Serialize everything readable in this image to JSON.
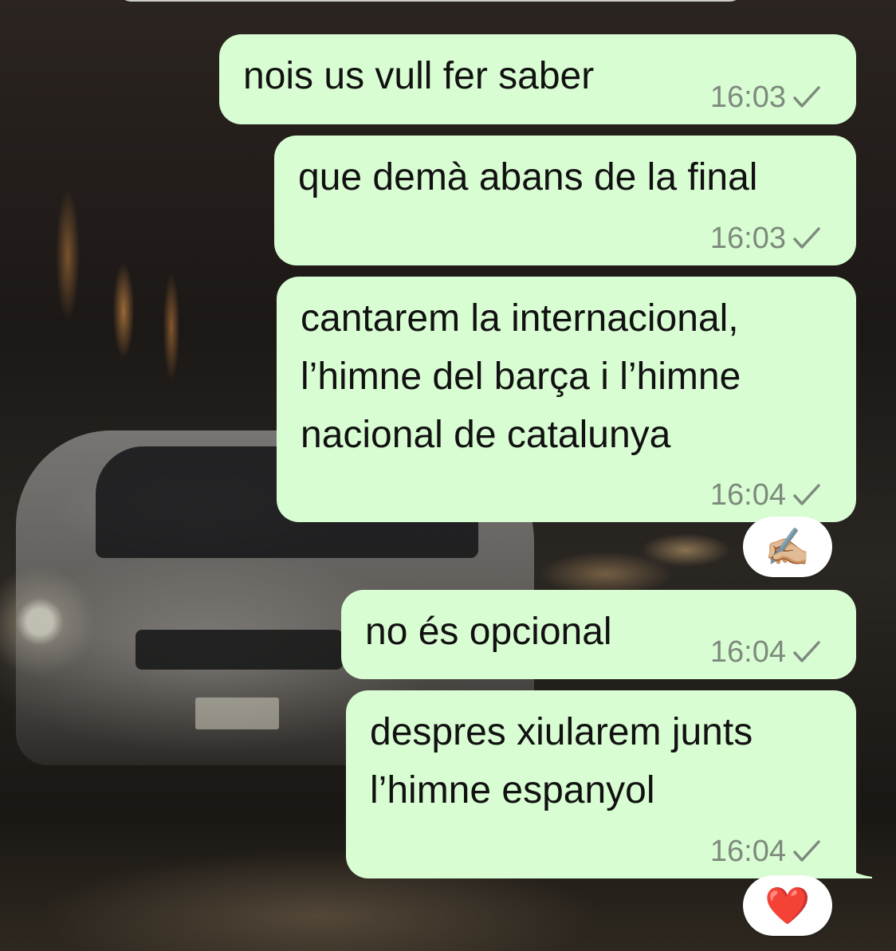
{
  "messages": [
    {
      "text_lines": [
        "nois us vull fer saber"
      ],
      "time": "16:03"
    },
    {
      "text_lines": [
        "que demà abans de la final"
      ],
      "time": "16:03"
    },
    {
      "text_lines": [
        "cantarem la internacional,",
        "l’himne del barça i l’himne",
        "nacional de catalunya"
      ],
      "time": "16:04",
      "reaction": "✍🏼"
    },
    {
      "text_lines": [
        "no és opcional"
      ],
      "time": "16:04"
    },
    {
      "text_lines": [
        "despres xiularem junts",
        "l’himne espanyol"
      ],
      "time": "16:04",
      "reaction": "❤️"
    }
  ],
  "icons": {
    "status": "single-check-icon"
  },
  "colors": {
    "bubble": "#d9fdd3",
    "meta": "#7d8a7d",
    "heart": "#e0202a"
  }
}
